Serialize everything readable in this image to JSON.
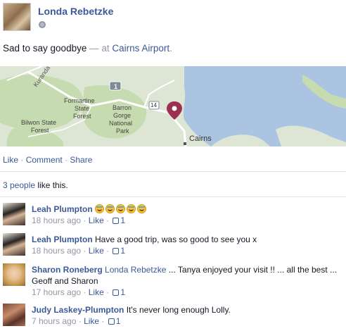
{
  "post": {
    "author": "Londa Rebetzke",
    "status_text": "Sad to say goodbye",
    "status_separator": " — at ",
    "place": "Cairns Airport",
    "status_end": ".",
    "privacy_icon": "globe-icon"
  },
  "map": {
    "labels": {
      "kuranda": "Kuranda St",
      "formartine": "Formartine",
      "state1": "State",
      "forest1": "Forest",
      "barron": "Barron",
      "gorge": "Gorge",
      "national": "National",
      "park": "Park",
      "bilwon": "Bilwon State",
      "forest2": "Forest",
      "cairns": "Cairns",
      "road1": "1",
      "road14": "14"
    },
    "colors": {
      "land": "#dde6d4",
      "forest": "#c6dbb0",
      "water": "#aac4e2",
      "road": "#ffffff",
      "pin": "#9c3050"
    }
  },
  "actions": {
    "like": "Like",
    "comment": "Comment",
    "share": "Share",
    "sep": " · "
  },
  "likes": {
    "people": "3 people",
    "suffix": " like this."
  },
  "comments": [
    {
      "name": "Leah Plumpton",
      "text": "",
      "emoji_count": 5,
      "time": "18 hours ago",
      "like": "Like",
      "likes": "1"
    },
    {
      "name": "Leah Plumpton",
      "text": "Have a good trip, was so good to see you x",
      "time": "18 hours ago",
      "like": "Like",
      "likes": "1"
    },
    {
      "name": "Sharon Roneberg",
      "mention": "Londa Rebetzke",
      "text": " ... Tanya enjoyed your visit !! ... all the best ... Geoff and Sharon",
      "time": "17 hours ago",
      "like": "Like",
      "likes": "1"
    },
    {
      "name": "Judy Laskey-Plumpton",
      "text": "It's never long enough Lolly.",
      "time": "7 hours ago",
      "like": "Like",
      "likes": "1"
    }
  ]
}
